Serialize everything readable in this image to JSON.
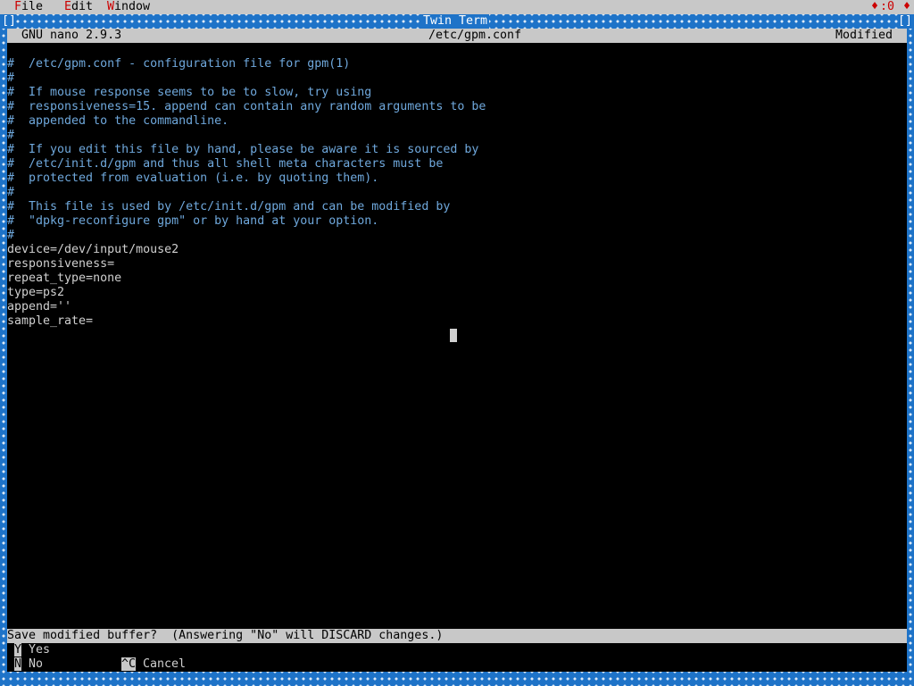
{
  "menubar": {
    "items": [
      {
        "hot": "F",
        "rest": "ile"
      },
      {
        "hot": "E",
        "rest": "dit"
      },
      {
        "hot": "W",
        "rest": "indow"
      }
    ],
    "clock": ":0"
  },
  "window": {
    "title": "Twin Term",
    "left_button": "[]",
    "right_button": "[]"
  },
  "nano": {
    "version": "GNU nano 2.9.3",
    "filename": "/etc/gpm.conf",
    "state": "Modified"
  },
  "editor": {
    "lines": [
      {
        "text": "#  /etc/gpm.conf - configuration file for gpm(1)",
        "kind": "comment"
      },
      {
        "text": "#",
        "kind": "comment"
      },
      {
        "text": "#  If mouse response seems to be to slow, try using",
        "kind": "comment"
      },
      {
        "text": "#  responsiveness=15. append can contain any random arguments to be",
        "kind": "comment"
      },
      {
        "text": "#  appended to the commandline.",
        "kind": "comment"
      },
      {
        "text": "#",
        "kind": "comment"
      },
      {
        "text": "#  If you edit this file by hand, please be aware it is sourced by",
        "kind": "comment"
      },
      {
        "text": "#  /etc/init.d/gpm and thus all shell meta characters must be",
        "kind": "comment"
      },
      {
        "text": "#  protected from evaluation (i.e. by quoting them).",
        "kind": "comment"
      },
      {
        "text": "#",
        "kind": "comment"
      },
      {
        "text": "#  This file is used by /etc/init.d/gpm and can be modified by",
        "kind": "comment"
      },
      {
        "text": "#  \"dpkg-reconfigure gpm\" or by hand at your option.",
        "kind": "comment"
      },
      {
        "text": "#",
        "kind": "comment"
      },
      {
        "text": "device=/dev/input/mouse2",
        "kind": "code"
      },
      {
        "text": "responsiveness=",
        "kind": "code"
      },
      {
        "text": "repeat_type=none",
        "kind": "code"
      },
      {
        "text": "type=ps2",
        "kind": "code"
      },
      {
        "text": "append=''",
        "kind": "code"
      },
      {
        "text": "sample_rate=",
        "kind": "code"
      }
    ]
  },
  "prompt": {
    "text": "Save modified buffer?  (Answering \"No\" will DISCARD changes.)"
  },
  "shortcuts": {
    "yes": {
      "key": "Y",
      "label": "Yes"
    },
    "no": {
      "key": "N",
      "label": "No"
    },
    "cancel": {
      "key": "^C",
      "label": "Cancel"
    }
  },
  "colors": {
    "frame": "#1e73c8",
    "bar": "#c8c8c8",
    "comment": "#6fa8dc",
    "hotkey": "#cc0000"
  }
}
